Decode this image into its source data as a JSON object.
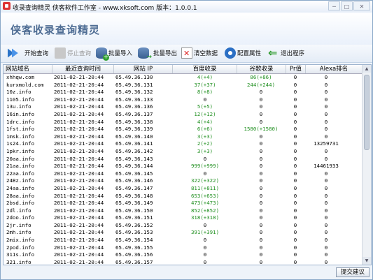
{
  "window": {
    "title": "收录查询精灵 侠客软件工作室 - www.xksoft.com 版本：1.0.0.1",
    "min": "─",
    "max": "□",
    "close": "✕"
  },
  "banner": {
    "title": "侠客收录查询精灵"
  },
  "toolbar": {
    "start": "开始查询",
    "stop": "停止查询",
    "import": "批量导入",
    "export": "批量导出",
    "clear": "清空数据",
    "config": "配置属性",
    "exit": "退出程序"
  },
  "table": {
    "headers": [
      "网站域名",
      "最近查询时间",
      "网站 IP",
      "百度收录",
      "谷歌收录",
      "Pr值",
      "Alexa排名"
    ],
    "rows": [
      [
        "xhhqw.com",
        "2011-02-21-20:44",
        "65.49.36.130",
        "4(+4)",
        "86(+86)",
        "0",
        "0"
      ],
      [
        "kurxmold.com",
        "2011-02-21-20:44",
        "65.49.36.131",
        "37(+37)",
        "244(+244)",
        "0",
        "0"
      ],
      [
        "10z.info",
        "2011-02-21-20:44",
        "65.49.36.132",
        "8(+8)",
        "0",
        "0",
        "0"
      ],
      [
        "1105.info",
        "2011-02-21-20:44",
        "65.49.36.133",
        "0",
        "0",
        "0",
        "0"
      ],
      [
        "13u.info",
        "2011-02-21-20:44",
        "65.49.36.136",
        "5(+5)",
        "0",
        "0",
        "0"
      ],
      [
        "16in.info",
        "2011-02-21-20:44",
        "65.49.36.137",
        "12(+12)",
        "0",
        "0",
        "0"
      ],
      [
        "1drc.info",
        "2011-02-21-20:44",
        "65.49.36.138",
        "4(+4)",
        "0",
        "0",
        "0"
      ],
      [
        "1fst.info",
        "2011-02-21-20:44",
        "65.49.36.139",
        "6(+6)",
        "1580(+1580)",
        "0",
        "0"
      ],
      [
        "1msk.info",
        "2011-02-21-20:44",
        "65.49.36.140",
        "3(+3)",
        "0",
        "0",
        "0"
      ],
      [
        "1s24.info",
        "2011-02-21-20:44",
        "65.49.36.141",
        "2(+2)",
        "0",
        "0",
        "13259731"
      ],
      [
        "1pkr.info",
        "2011-02-21-20:44",
        "65.49.36.142",
        "3(+3)",
        "0",
        "0",
        "0"
      ],
      [
        "20aa.info",
        "2011-02-21-20:44",
        "65.49.36.143",
        "0",
        "0",
        "0",
        "0"
      ],
      [
        "21aa.info",
        "2011-02-21-20:44",
        "65.49.36.144",
        "999(+999)",
        "0",
        "0",
        "14461933"
      ],
      [
        "22aa.info",
        "2011-02-21-20:44",
        "65.49.36.145",
        "0",
        "0",
        "0",
        "0"
      ],
      [
        "24Bz.info",
        "2011-02-21-20:44",
        "65.49.36.146",
        "322(+322)",
        "0",
        "0",
        "0"
      ],
      [
        "24aa.info",
        "2011-02-21-20:44",
        "65.49.36.147",
        "811(+811)",
        "0",
        "0",
        "0"
      ],
      [
        "28aa.info",
        "2011-02-21-20:44",
        "65.49.36.148",
        "653(+653)",
        "0",
        "0",
        "0"
      ],
      [
        "2bsd.info",
        "2011-02-21-20:44",
        "65.49.36.149",
        "473(+473)",
        "0",
        "0",
        "0"
      ],
      [
        "2dl.info",
        "2011-02-21-20:44",
        "65.49.36.150",
        "852(+852)",
        "0",
        "0",
        "0"
      ],
      [
        "2doo.info",
        "2011-02-21-20:44",
        "65.49.36.151",
        "318(+318)",
        "0",
        "0",
        "0"
      ],
      [
        "2jr.info",
        "2011-02-21-20:44",
        "65.49.36.152",
        "0",
        "0",
        "0",
        "0"
      ],
      [
        "2mh.info",
        "2011-02-21-20:44",
        "65.49.36.153",
        "391(+391)",
        "0",
        "0",
        "0"
      ],
      [
        "2mix.info",
        "2011-02-21-20:44",
        "65.49.36.154",
        "0",
        "0",
        "0",
        "0"
      ],
      [
        "2pod.info",
        "2011-02-21-20:44",
        "65.49.36.155",
        "0",
        "0",
        "0",
        "0"
      ],
      [
        "311s.info",
        "2011-02-21-20:44",
        "65.49.36.156",
        "0",
        "0",
        "0",
        "0"
      ],
      [
        "321.info",
        "2011-02-21-20:44",
        "65.49.36.157",
        "0",
        "0",
        "0",
        "0"
      ]
    ]
  },
  "scrollbar": {
    "up": "▲",
    "down": "▼"
  },
  "status": {
    "submit": "提交建议"
  },
  "colors": {
    "count_green": "#1f8f1f",
    "header_title": "#4f6d94"
  }
}
